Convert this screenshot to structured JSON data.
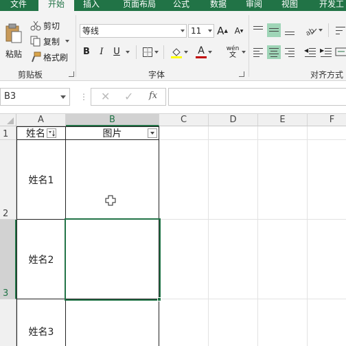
{
  "tabs": [
    {
      "label": "文件",
      "active": false
    },
    {
      "label": "开始",
      "active": true
    },
    {
      "label": "插入",
      "active": false
    },
    {
      "label": "页面布局",
      "active": false
    },
    {
      "label": "公式",
      "active": false
    },
    {
      "label": "数据",
      "active": false
    },
    {
      "label": "审阅",
      "active": false
    },
    {
      "label": "视图",
      "active": false
    },
    {
      "label": "开发工",
      "active": false
    }
  ],
  "clipboard": {
    "paste": "粘贴",
    "cut": "剪切",
    "copy": "复制",
    "format_painter": "格式刷",
    "group_label": "剪贴板"
  },
  "font": {
    "name": "等线",
    "size": "11",
    "bold": "B",
    "italic": "I",
    "underline": "U",
    "grow": "A",
    "shrink": "A",
    "color_letter": "A",
    "phonetic": "wén",
    "group_label": "字体"
  },
  "alignment": {
    "group_label": "对齐方式"
  },
  "formula_bar": {
    "name_box": "B3",
    "fx": "fx",
    "value": ""
  },
  "grid": {
    "columns": [
      "A",
      "B",
      "C",
      "D",
      "E",
      "F"
    ],
    "rows": [
      "1",
      "2",
      "3"
    ],
    "header_a": "姓名",
    "header_b": "图片",
    "names": [
      "姓名1",
      "姓名2",
      "姓名3"
    ],
    "selected_cell": "B3"
  },
  "colors": {
    "accent": "#217346",
    "selection_fill": "#9fd5b7",
    "font_color": "#c00000",
    "highlight": "#ffff00"
  }
}
